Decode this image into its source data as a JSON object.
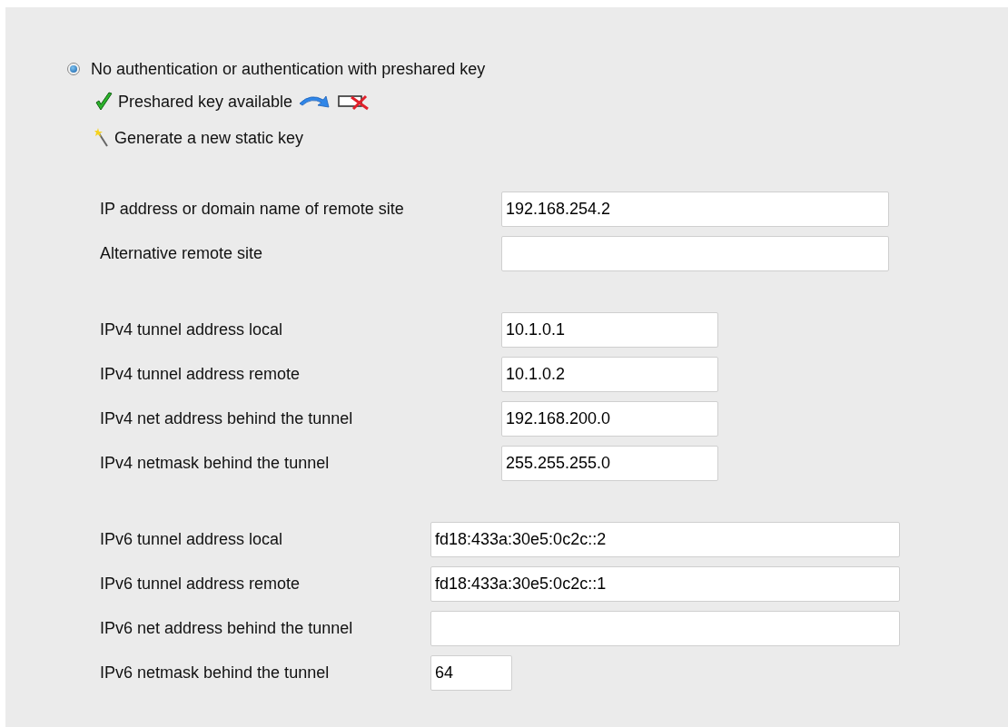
{
  "auth_option": {
    "label": "No authentication or authentication with preshared key",
    "selected": true
  },
  "key_status": {
    "label": "Preshared key available"
  },
  "generate_key": {
    "label": "Generate a new static key"
  },
  "groups": [
    {
      "fields": [
        {
          "label": "IP address or domain name of remote site",
          "value": "192.168.254.2"
        },
        {
          "label": "Alternative remote site"
        }
      ]
    },
    {
      "fields": [
        {
          "label": "IPv4 tunnel address local",
          "value": "10.1.0.1"
        },
        {
          "label": "IPv4 tunnel address remote",
          "value": "10.1.0.2"
        },
        {
          "label": "IPv4 net address behind the tunnel",
          "value": "192.168.200.0"
        },
        {
          "label": "IPv4 netmask behind the tunnel",
          "value": "255.255.255.0"
        }
      ]
    },
    {
      "fields": [
        {
          "label": "IPv6 tunnel address local",
          "value": "fd18:433a:30e5:0c2c::2"
        },
        {
          "label": "IPv6 tunnel address remote",
          "value": "fd18:433a:30e5:0c2c::1"
        },
        {
          "label": "IPv6 net address behind the tunnel"
        },
        {
          "label": "IPv6 netmask behind the tunnel",
          "value": "64"
        }
      ]
    }
  ]
}
